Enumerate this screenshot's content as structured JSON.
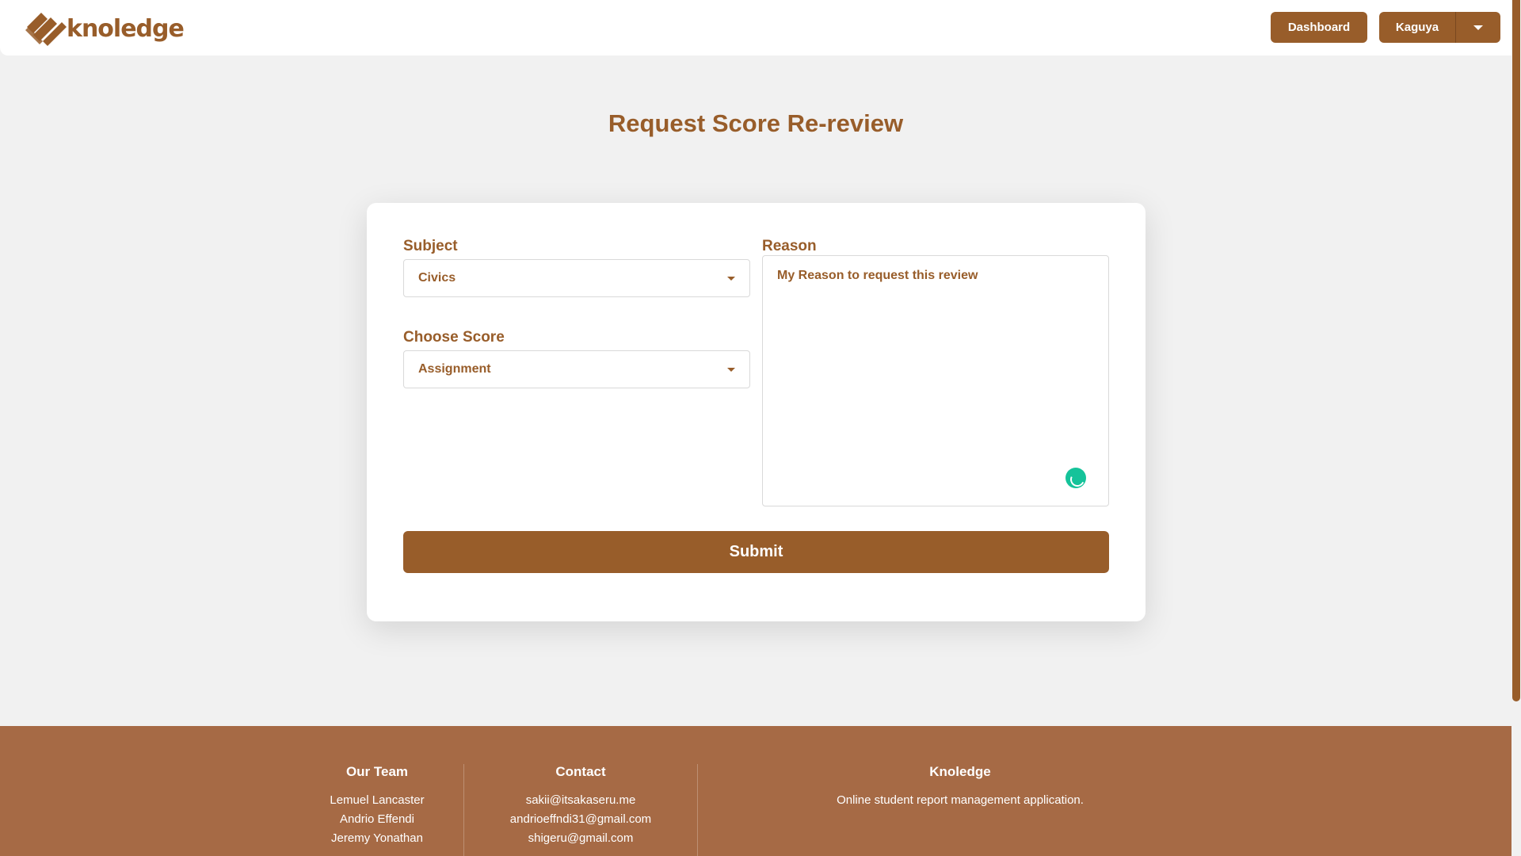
{
  "header": {
    "logo_text": "knoledge",
    "dashboard_label": "Dashboard",
    "user_label": "Kaguya"
  },
  "page": {
    "title": "Request Score Re-review"
  },
  "form": {
    "subject_label": "Subject",
    "subject_value": "Civics",
    "score_label": "Choose Score",
    "score_value": "Assignment",
    "reason_label": "Reason",
    "reason_value": "My Reason to request this review",
    "submit_label": "Submit"
  },
  "footer": {
    "team": {
      "heading": "Our Team",
      "members": [
        "Lemuel Lancaster",
        "Andrio Effendi",
        "Jeremy Yonathan"
      ]
    },
    "contact": {
      "heading": "Contact",
      "emails": [
        "sakii@itsakaseru.me",
        "andrioeffndi31@gmail.com",
        "shigeru@gmail.com"
      ]
    },
    "about": {
      "heading": "Knoledge",
      "description": "Online student report management application."
    }
  },
  "colors": {
    "brand": "#985d2a",
    "footer": "#a66a45",
    "background": "#f1f1f1",
    "grammar_icon": "#15c39a"
  },
  "icons": [
    "logo-mark-icon",
    "chevron-down-icon",
    "grammar-assistant-icon"
  ]
}
